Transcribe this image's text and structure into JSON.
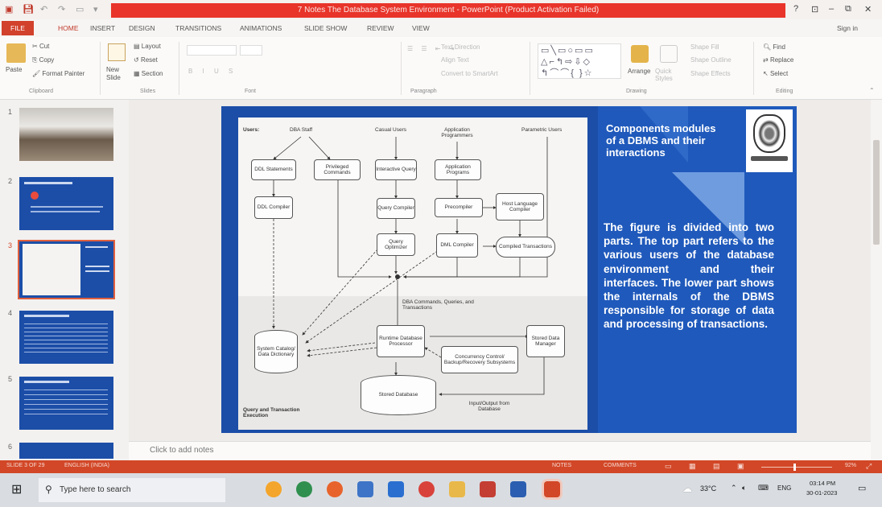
{
  "window": {
    "title": "7 Notes The Database System Environment - PowerPoint (Product Activation Failed)",
    "sign_in": "Sign in",
    "controls": [
      "?",
      "⊡",
      "–",
      "⧉",
      "✕"
    ]
  },
  "tabs": [
    "FILE",
    "HOME",
    "INSERT",
    "DESIGN",
    "TRANSITIONS",
    "ANIMATIONS",
    "SLIDE SHOW",
    "REVIEW",
    "VIEW"
  ],
  "ribbon": {
    "clipboard": {
      "paste": "Paste",
      "cut": "Cut",
      "copy": "Copy",
      "format_painter": "Format Painter",
      "group": "Clipboard"
    },
    "slides": {
      "new_slide": "New Slide",
      "layout": "Layout",
      "reset": "Reset",
      "section": "Section",
      "group": "Slides"
    },
    "font": {
      "group": "Font"
    },
    "paragraph": {
      "text_direction": "Text Direction",
      "align_text": "Align Text",
      "convert_smartart": "Convert to SmartArt",
      "group": "Paragraph"
    },
    "drawing": {
      "arrange": "Arrange",
      "quick_styles": "Quick Styles",
      "shape_fill": "Shape Fill",
      "shape_outline": "Shape Outline",
      "shape_effects": "Shape Effects",
      "group": "Drawing"
    },
    "editing": {
      "find": "Find",
      "replace": "Replace",
      "select": "Select",
      "group": "Editing"
    }
  },
  "thumbnails": [
    {
      "num": "1"
    },
    {
      "num": "2"
    },
    {
      "num": "3",
      "selected": true
    },
    {
      "num": "4"
    },
    {
      "num": "5"
    },
    {
      "num": "6"
    }
  ],
  "slide": {
    "title": "Components modules of a DBMS and their interactions",
    "body": "The figure is divided into two parts. The top part refers to the various users of the database environment and their interfaces. The lower part shows the internals of the DBMS responsible for storage of data and processing of transactions.",
    "diagram": {
      "users_label": "Users:",
      "users": [
        "DBA Staff",
        "Casual Users",
        "Application Programmers",
        "Parametric Users"
      ],
      "boxes": {
        "ddl_statements": "DDL Statements",
        "privileged_commands": "Privileged Commands",
        "interactive_query": "Interactive Query",
        "application_programs": "Application Programs",
        "ddl_compiler": "DDL Compiler",
        "query_compiler": "Query Compiler",
        "precompiler": "Precompiler",
        "host_language_compiler": "Host Language Compiler",
        "query_optimizer": "Query Optimizer",
        "dml_compiler": "DML Compiler",
        "compiled_transactions": "Compiled Transactions",
        "system_catalog": "System Catalog/ Data Dictionary",
        "runtime_processor": "Runtime Database Processor",
        "stored_data_manager": "Stored Data Manager",
        "concurrency": "Concurrency Control/ Backup/Recovery Subsystems",
        "stored_database": "Stored Database"
      },
      "labels": {
        "dba_commands": "DBA Commands, Queries, and Transactions",
        "io": "Input/Output from Database",
        "section": "Query and Transaction Execution"
      }
    }
  },
  "notes_placeholder": "Click to add notes",
  "status": {
    "slide_info": "SLIDE 3 OF 29",
    "language": "ENGLISH (INDIA)",
    "notes": "NOTES",
    "comments": "COMMENTS",
    "zoom": "92%"
  },
  "taskbar": {
    "search_placeholder": "Type here to search",
    "weather": "33°C",
    "lang": "ENG",
    "time": "03:14 PM",
    "date": "30-01-2023"
  },
  "colors": {
    "accent": "#d24727",
    "slide_blue": "#1c4ea8"
  }
}
